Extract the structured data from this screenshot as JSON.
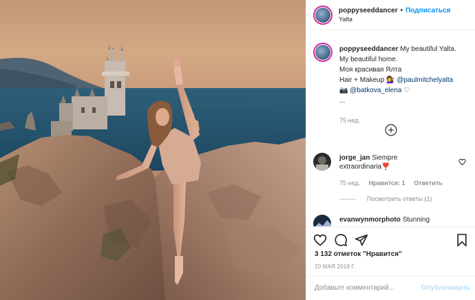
{
  "post": {
    "username": "poppyseeddancer",
    "separator": "•",
    "follow_label": "Подписаться",
    "location": "Yalta",
    "caption": {
      "username": "poppyseeddancer",
      "line1": "My beautiful Yalta.",
      "line2": "My beautiful home.",
      "line3": "Моя красивая Ялта",
      "line4_prefix": "Hair + Makeup",
      "line4_emoji": "💇‍♀️",
      "mention1": "@paulmitchelyalta",
      "line5_emoji": "📷",
      "mention2": "@batkova_elena",
      "line5_suffix": "♡",
      "ellipsis": "...",
      "time": "75 нед."
    },
    "load_more_icon": "plus-circle-icon",
    "comments": [
      {
        "username": "jorge_jan",
        "text": "Siempre extraordinaria",
        "emoji": "❣️",
        "time": "75 нед.",
        "likes": "Нравится: 1",
        "reply": "Ответить",
        "view_replies": "Посмотреть ответы (1)"
      },
      {
        "username": "evanwynmorphoto",
        "text": "Stunning"
      }
    ],
    "likes_count": "3 132 отметок \"Нравится\"",
    "date": "20 МАЯ 2019 Г.",
    "add_comment_placeholder": "Добавьте комментарий...",
    "publish_label": "Опубликовать",
    "icons": {
      "like": "heart-icon",
      "comment": "comment-icon",
      "share": "share-icon",
      "save": "bookmark-icon"
    },
    "colors": {
      "link": "#0095f6",
      "mention": "#00376b",
      "muted": "#8e8e8e",
      "publish_disabled": "#b2dffc"
    }
  }
}
